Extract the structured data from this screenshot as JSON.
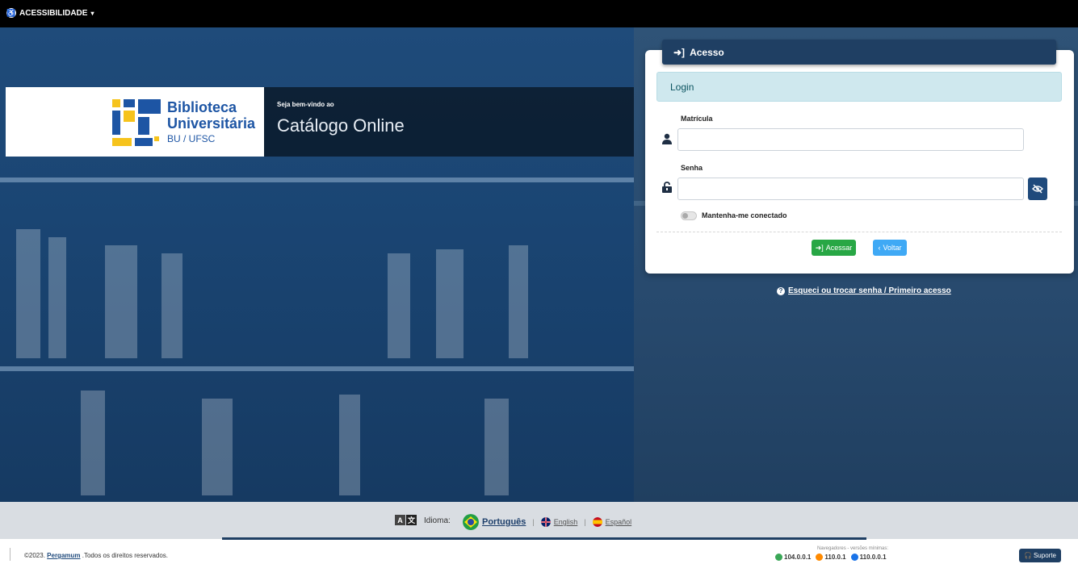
{
  "accessibility": {
    "label": "ACESSIBILIDADE",
    "icon": "accessibility-icon"
  },
  "logo": {
    "title_line1": "Biblioteca",
    "title_line2": "Universitária",
    "subtitle": "BU / UFSC",
    "colors": {
      "blue": "#1d55a4",
      "yellow": "#f6c31c"
    }
  },
  "welcome": {
    "small": "Seja bem-vindo ao",
    "big": "Catálogo Online"
  },
  "login_card": {
    "header_title": "Acesso",
    "alert": "Login",
    "matricula_label": "Matrícula",
    "matricula_value": "",
    "senha_label": "Senha",
    "senha_value": "",
    "remember_label": "Mantenha-me conectado",
    "remember_on": false,
    "access_button": "Acessar",
    "back_button": "Voltar",
    "forgot_link": "Esqueci ou trocar senha / Primeiro acesso"
  },
  "language": {
    "label": "Idioma:",
    "options": [
      {
        "label": "Português",
        "active": true
      },
      {
        "label": "English",
        "active": false
      },
      {
        "label": "Español",
        "active": false
      }
    ]
  },
  "footer": {
    "copyright_prefix": "©2023.",
    "brand": "Pergamum",
    "copyright_suffix": ".Todos os direitos reservados.",
    "browsers_title": "Navegadores - versões mínimas:",
    "browsers": [
      {
        "version": "104.0.0.1",
        "color": "#3aa757"
      },
      {
        "version": "110.0.1",
        "color": "#ff8a00"
      },
      {
        "version": "110.0.0.1",
        "color": "#1a73e8"
      }
    ],
    "support_button": "Suporte"
  },
  "colors": {
    "accent_dark": "#1f3f63",
    "success": "#28a745",
    "info": "#3fa9f5"
  }
}
